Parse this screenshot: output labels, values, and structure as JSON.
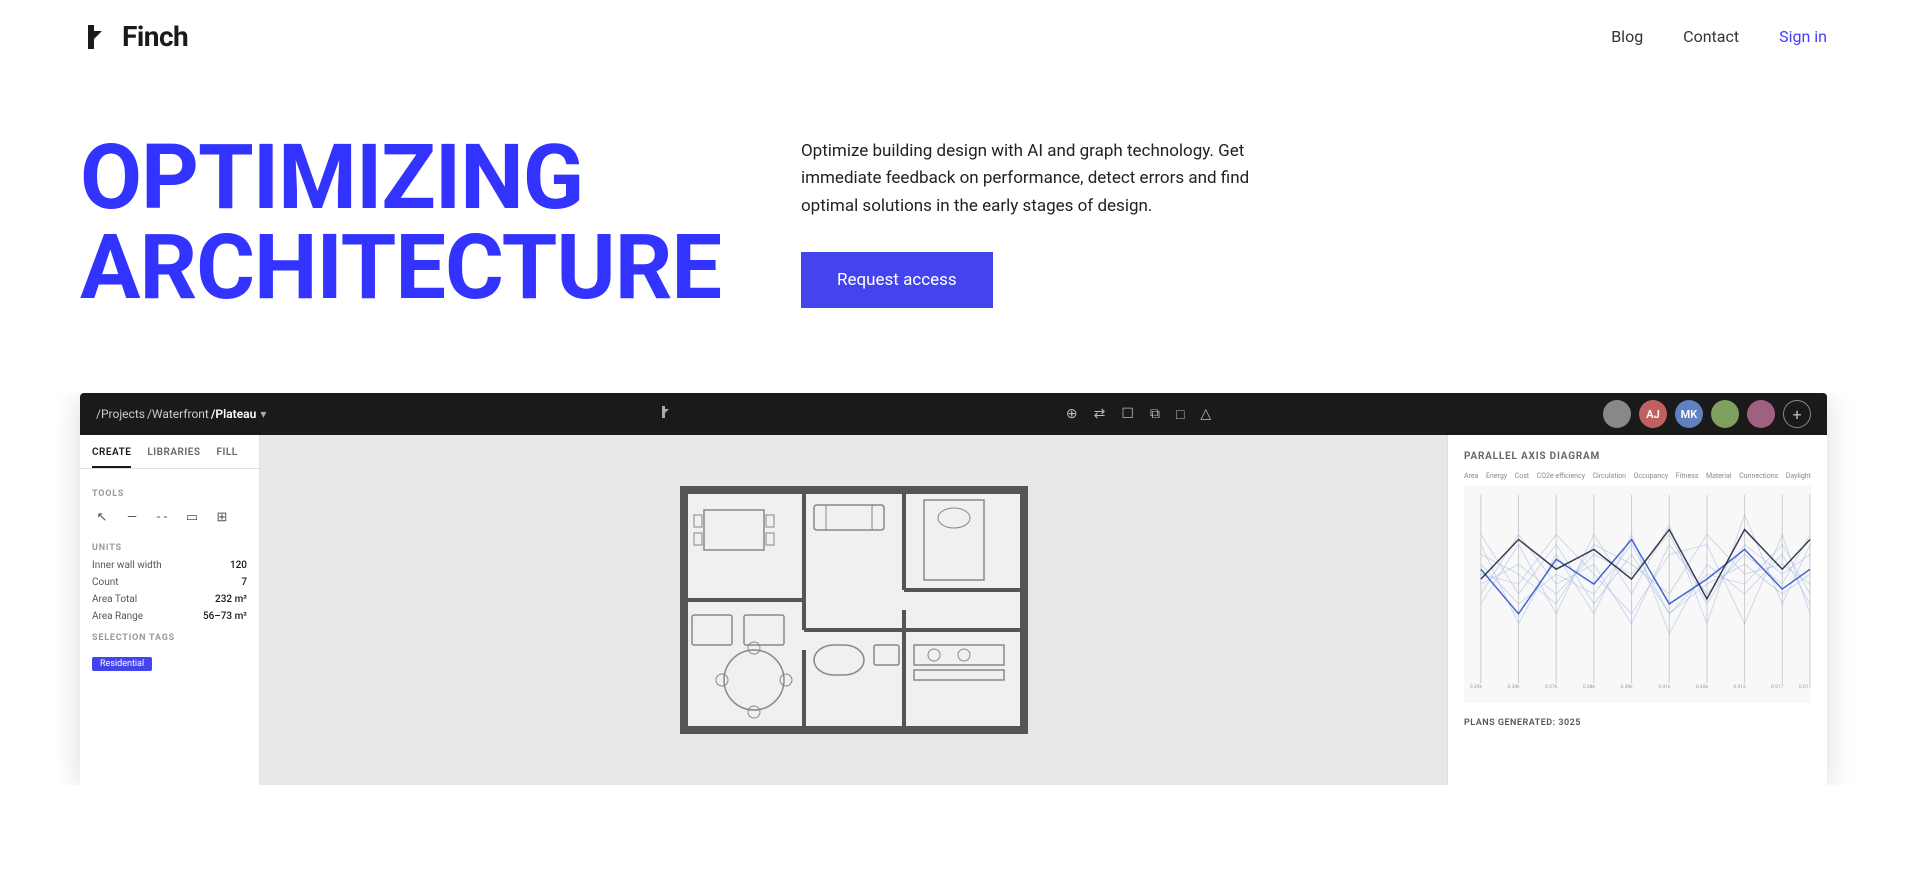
{
  "header": {
    "logo_text": "Finch",
    "nav": {
      "blog_label": "Blog",
      "contact_label": "Contact",
      "signin_label": "Sign in"
    }
  },
  "hero": {
    "title_line1": "OPTIMIZING",
    "title_line2": "ARCHITECTURE",
    "description": "Optimize building design with AI and graph technology. Get immediate feedback on performance, detect errors and find optimal solutions in the early stages of design.",
    "cta_label": "Request access"
  },
  "app": {
    "breadcrumb": {
      "projects": "/Projects",
      "waterfront": "/Waterfront",
      "plateau": "/Plateau"
    },
    "toolbar_center_icons": [
      "pin",
      "shuffle",
      "chat",
      "copy",
      "square",
      "triangle"
    ],
    "sidebar": {
      "tabs": [
        "CREATE",
        "LIBRARIES",
        "FILL"
      ],
      "active_tab": "CREATE",
      "tools_section": "TOOLS",
      "units_section": "UNITS",
      "units_rows": [
        {
          "label": "Inner wall width",
          "value": "120"
        },
        {
          "label": "Count",
          "value": "7"
        },
        {
          "label": "Area Total",
          "value": "232 m²"
        },
        {
          "label": "Area Range",
          "value": "56–73 m²"
        }
      ],
      "selection_tags_section": "SELECTION TAGS"
    },
    "right_panel": {
      "title": "PARALLEL AXIS DIAGRAM",
      "chart_axes": [
        "Area",
        "Energy",
        "Cost",
        "CO2e efficiency",
        "Circulation",
        "Occupancy",
        "Fitness",
        "Material",
        "Connections",
        "Daylight"
      ],
      "plans_generated_label": "PLANS GENERATED: 3025"
    }
  },
  "colors": {
    "brand_blue": "#3333ff",
    "nav_signin": "#4040ff",
    "cta_button": "#4444ee",
    "logo_text": "#1a1a1a",
    "toolbar_bg": "#1a1a1a"
  }
}
